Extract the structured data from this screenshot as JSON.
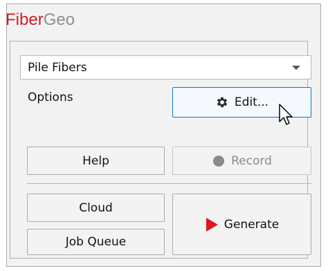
{
  "app": {
    "title_part1": "Fiber",
    "title_part2": "Geo"
  },
  "colors": {
    "brand_red": "#cc1f24",
    "title_grey": "#8f8f8f",
    "focus_blue": "#0078d7"
  },
  "preset": {
    "selected": "Pile Fibers"
  },
  "options": {
    "label": "Options",
    "edit_label": "Edit...",
    "edit_icon": "gear-icon"
  },
  "buttons": {
    "help": "Help",
    "record": "Record",
    "record_icon": "record-circle-icon",
    "cloud": "Cloud",
    "job_queue": "Job Queue",
    "generate": "Generate",
    "generate_icon": "play-icon"
  }
}
